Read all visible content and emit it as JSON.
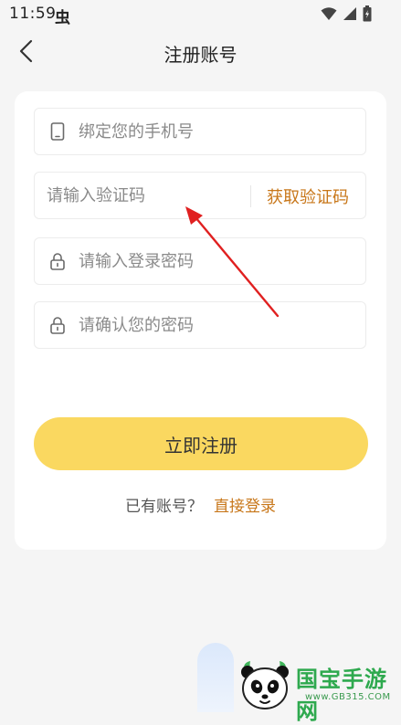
{
  "status_bar": {
    "time": "11:59",
    "app_icon_glyph": "虫",
    "icons": [
      "wifi-icon",
      "signal-icon",
      "battery-icon"
    ]
  },
  "header": {
    "title": "注册账号",
    "back_icon": "chevron-left-icon"
  },
  "form": {
    "phone_placeholder": "绑定您的手机号",
    "code_placeholder": "请输入验证码",
    "get_code_label": "获取验证码",
    "password_placeholder": "请输入登录密码",
    "confirm_placeholder": "请确认您的密码"
  },
  "actions": {
    "register_label": "立即注册",
    "login_prompt": "已有账号？",
    "login_link": "直接登录"
  },
  "watermark": {
    "title": "国宝手游网",
    "subtitle": "www.GB315.COM"
  },
  "colors": {
    "accent": "#c8771a",
    "button": "#fad860",
    "annotation": "#e02020",
    "background": "#f5f5f5"
  }
}
